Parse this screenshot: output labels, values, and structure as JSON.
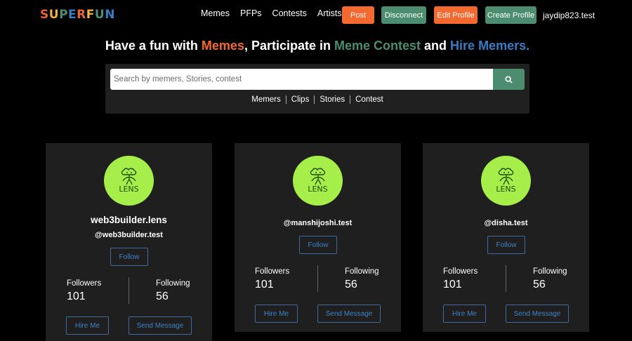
{
  "nav": {
    "logo": [
      "S",
      "U",
      "P",
      "E",
      "R",
      "F",
      "U",
      "N"
    ],
    "logo_colors": [
      "#e8663a",
      "#f0b33c",
      "#4c8d70",
      "#3a7cc4",
      "#e8663a",
      "#f0b33c",
      "#4c8d70",
      "#3a7cc4"
    ],
    "links": [
      "Memes",
      "PFPs",
      "Contests",
      "Artists"
    ],
    "post_label": "Post",
    "disconnect_label": "Disconnect",
    "edit_profile_label": "Edit Profile",
    "create_profile_label": "Create Profile",
    "username": "jaydip823.test"
  },
  "colors": {
    "orange": "#f4692f",
    "green": "#4c8d70",
    "blue": "#3a7cc4",
    "lens_green": "#a6ee4a"
  },
  "headline": {
    "p1": "Have a fun with ",
    "memes": "Memes",
    "p2": ", Participate in ",
    "contest": "Meme Contest",
    "p3": " and ",
    "hire": "Hire Memers."
  },
  "search": {
    "placeholder": "Search by memers, Stories, contest",
    "filters": [
      "Memers",
      "Clips",
      "Stories",
      "Contest"
    ]
  },
  "profiles": [
    {
      "name": "web3builder.lens",
      "handle": "@web3builder.test",
      "follow_label": "Follow",
      "followers_label": "Followers",
      "followers": "101",
      "following_label": "Following",
      "following": "56",
      "hire_label": "Hire Me",
      "message_label": "Send Message",
      "avatar_text": "LENS"
    },
    {
      "name": "",
      "handle": "@manshijoshi.test",
      "follow_label": "Follow",
      "followers_label": "Followers",
      "followers": "101",
      "following_label": "Following",
      "following": "56",
      "hire_label": "Hire Me",
      "message_label": "Send Message",
      "avatar_text": "LENS"
    },
    {
      "name": "",
      "handle": "@disha.test",
      "follow_label": "Follow",
      "followers_label": "Followers",
      "followers": "101",
      "following_label": "Following",
      "following": "56",
      "hire_label": "Hire Me",
      "message_label": "Send Message",
      "avatar_text": "LENS"
    }
  ]
}
